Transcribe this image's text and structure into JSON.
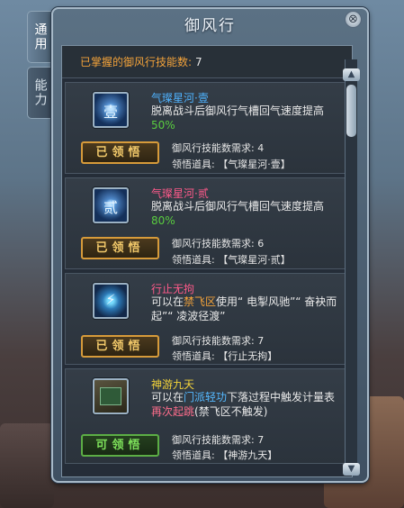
{
  "side_tabs": [
    "通用",
    "能力"
  ],
  "window": {
    "title": "御风行",
    "close_glyph": "⊗"
  },
  "summary": {
    "label": "已掌握的御风行技能数:",
    "value": "7"
  },
  "labels": {
    "req": "御风行技能数需求:",
    "item": "领悟道具:"
  },
  "entries": [
    {
      "icon": "star-icon",
      "icon_glyph": "壹",
      "name": "气璨星河·壹",
      "name_color": "#4fb3ff",
      "desc_plain": "脱离战斗后御风行气槽回气速度提高",
      "desc_hl": "50%",
      "button": "已领悟",
      "req": "4",
      "item": "【气璨星河·壹】"
    },
    {
      "icon": "star-icon",
      "icon_glyph": "贰",
      "name": "气璨星河·贰",
      "name_color": "#ff5a8a",
      "desc_plain": "脱离战斗后御风行气槽回气速度提高",
      "desc_hl": "80%",
      "button": "已领悟",
      "req": "6",
      "item": "【气璨星河·贰】"
    },
    {
      "icon": "running-figure-icon",
      "name": "行止无拘",
      "name_color": "#ff5a8a",
      "desc_parts": [
        "可以在",
        "禁飞区",
        "使用“ 电掣风驰”“ 奋袂而起”“ 凌波径渡”"
      ],
      "button": "已领悟",
      "req": "7",
      "item": "【行止无拘】"
    },
    {
      "icon": "book-icon",
      "name": "神游九天",
      "name_color": "#f2d23a",
      "desc_parts": [
        "可以在",
        "门派轻功",
        "下落过程中触发计量表",
        "再次起跳",
        "(禁飞区不触发)"
      ],
      "button": "可领悟",
      "req": "7",
      "item": "【神游九天】"
    }
  ],
  "scroll": {
    "up": "▲",
    "down": "▼"
  },
  "colors": {
    "accent_orange": "#f2a23a",
    "accent_green": "#59cc3f",
    "accent_cyan": "#55b9ff"
  }
}
